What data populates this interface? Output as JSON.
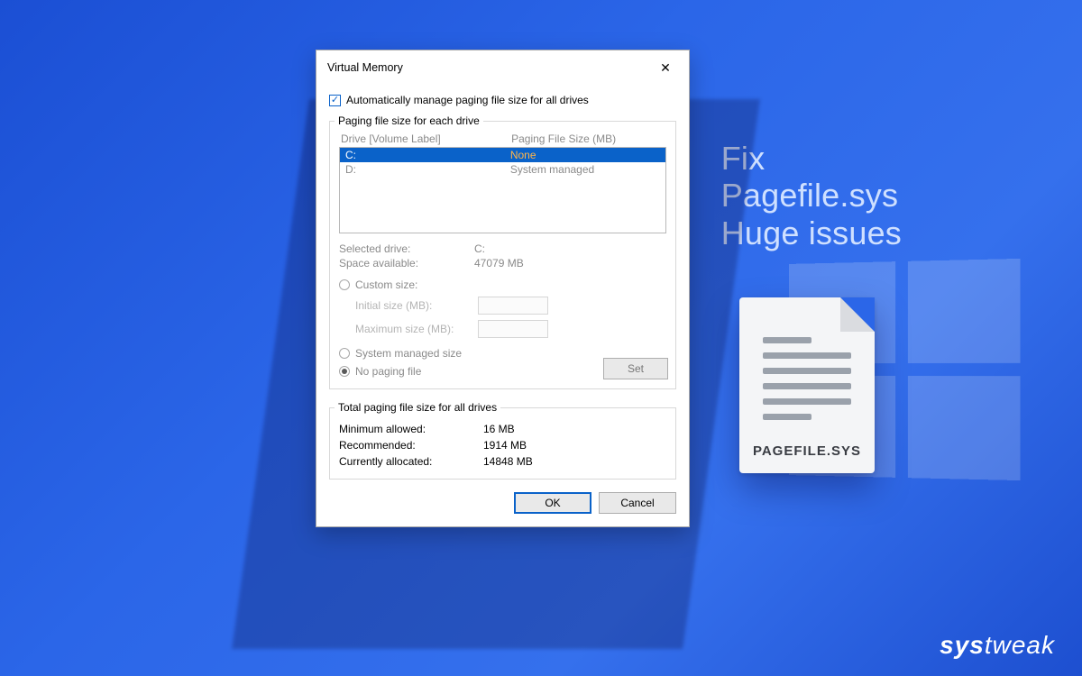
{
  "marketing": {
    "line1": "Fix",
    "line2": "Pagefile.sys",
    "line3": "Huge issues"
  },
  "brand": {
    "part1": "sys",
    "part2": "tweak"
  },
  "fileicon": {
    "label": "PAGEFILE.SYS"
  },
  "dialog": {
    "title": "Virtual Memory",
    "auto_manage_label": "Automatically manage paging file size for all drives",
    "auto_manage_checked": true,
    "section_drives_title": "Paging file size for each drive",
    "list_header_drive": "Drive  [Volume Label]",
    "list_header_size": "Paging File Size (MB)",
    "drives": [
      {
        "label": "C:",
        "size": "None",
        "selected": true
      },
      {
        "label": "D:",
        "size": "System managed",
        "selected": false
      }
    ],
    "selected_drive_label": "Selected drive:",
    "selected_drive_value": "C:",
    "space_available_label": "Space available:",
    "space_available_value": "47079 MB",
    "radio_custom": "Custom size:",
    "initial_size_label": "Initial size (MB):",
    "maximum_size_label": "Maximum size (MB):",
    "radio_system": "System managed size",
    "radio_none": "No paging file",
    "set_button": "Set",
    "totals_title": "Total paging file size for all drives",
    "min_allowed_label": "Minimum allowed:",
    "min_allowed_value": "16 MB",
    "recommended_label": "Recommended:",
    "recommended_value": "1914 MB",
    "current_label": "Currently allocated:",
    "current_value": "14848 MB",
    "ok": "OK",
    "cancel": "Cancel"
  }
}
